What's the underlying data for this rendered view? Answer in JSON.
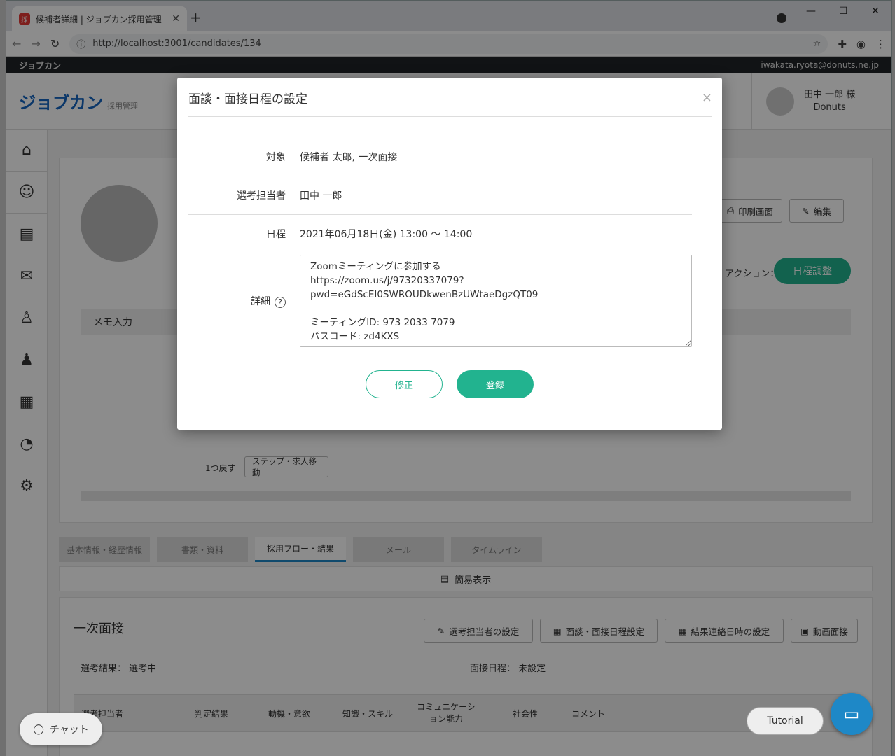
{
  "browser": {
    "tab_title": "候補者詳細 | ジョブカン採用管理",
    "favicon_text": "採",
    "url": "http://localhost:3001/candidates/134"
  },
  "app": {
    "brand_strip": "ジョブカン",
    "account_email": "iwakata.ryota@donuts.ne.jp",
    "logo": "ジョブカン",
    "logo_sub": "採用管理",
    "user_name": "田中 一郎 様",
    "user_company": "Donuts"
  },
  "background": {
    "print_button": "印刷画面",
    "edit_button": "編集",
    "action_label": "アクション：",
    "schedule_button": "日程調整",
    "memo_label": "メモ入力",
    "back_link": "1つ戻す",
    "step_move_button": "ステップ・求人移動",
    "tabs": [
      "基本情報・経歴情報",
      "書類・資料",
      "採用フロー・結果",
      "メール",
      "タイムライン"
    ],
    "simple_view": "簡易表示",
    "section_title": "一次面接",
    "set_examiner": "選考担当者の設定",
    "set_interview_date": "面談・面接日程設定",
    "set_result_date": "結果連絡日時の設定",
    "video_interview": "動画面接",
    "result_label": "選考結果：",
    "result_value": "選考中",
    "interview_date_label": "面接日程：",
    "interview_date_value": "未設定",
    "table_headers": [
      "選考担当者",
      "判定結果",
      "動機・意欲",
      "知識・スキル",
      "コミュニケーション能力",
      "社会性",
      "コメント"
    ],
    "tutorial": "Tutorial",
    "chat": "チャット"
  },
  "modal": {
    "title": "面談・面接日程の設定",
    "target_label": "対象",
    "target_value": "候補者 太郎, 一次面接",
    "examiner_label": "選考担当者",
    "examiner_value": "田中 一郎",
    "date_label": "日程",
    "date_value": "2021年06月18日(金) 13:00 ～ 14:00",
    "detail_label": "詳細",
    "detail_value": "Zoomミーティングに参加する\nhttps://zoom.us/j/97320337079?pwd=eGdScEI0SWROUDkwenBzUWtaeDgzQT09\n\nミーティングID: 973 2033 7079\nパスコード: zd4KXS",
    "edit_button": "修正",
    "register_button": "登録"
  }
}
